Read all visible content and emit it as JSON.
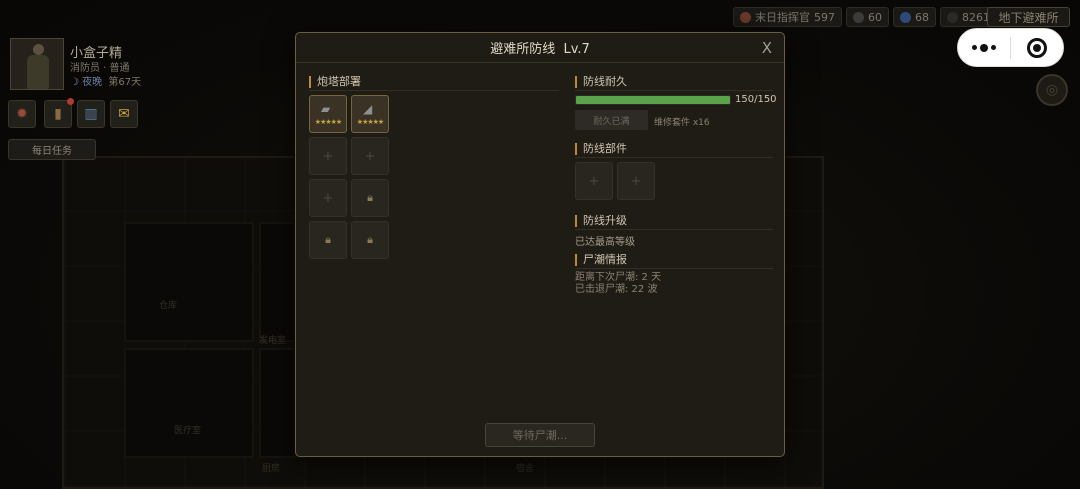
{
  "hud": {
    "resources": [
      {
        "name": "commander",
        "label": "末日指挥官",
        "value": "597",
        "color": "#6b3a2a"
      },
      {
        "name": "coin",
        "label": "",
        "value": "60",
        "color": "#3b3b3b"
      },
      {
        "name": "gem",
        "label": "",
        "value": "68",
        "color": "#2e4a7a"
      },
      {
        "name": "supply",
        "label": "",
        "value": "8261",
        "color": "#2c2a26"
      }
    ],
    "shelter_label": "地下避难所"
  },
  "player": {
    "name": "小盒子精",
    "job": "消防员 · 普通",
    "phase": "夜晚",
    "day": "第67天"
  },
  "side_buttons": [
    {
      "icon": "gear-icon"
    },
    {
      "icon": "notebook-icon",
      "badge": true
    },
    {
      "icon": "book-icon"
    },
    {
      "icon": "mail-icon"
    }
  ],
  "daily_task_label": "每日任务",
  "map": {
    "room_labels": [
      "仓库",
      "发电室",
      "医疗室",
      "厨房",
      "宿舍"
    ]
  },
  "modal": {
    "title": "避难所防线",
    "level": "Lv.7",
    "close_label": "X",
    "turret_section": "炮塔部署",
    "turret_slots": [
      "turret",
      "turret",
      "empty",
      "empty",
      "empty",
      "locked",
      "locked",
      "locked"
    ],
    "durability_section": "防线耐久",
    "durability": {
      "current": 150,
      "max": 150,
      "text": "150/150"
    },
    "repair_button": "耐久已满",
    "repair_kit": "维修套件 x16",
    "parts_section": "防线部件",
    "parts_slots": [
      "empty",
      "empty"
    ],
    "upgrade_section": "防线升级",
    "upgrade_status": "已达最高等级",
    "horde_section": "尸潮情报",
    "horde_next": "距离下次尸潮: 2 天",
    "horde_repelled": "已击退尸潮: 22 波",
    "wait_button": "等待尸潮..."
  }
}
